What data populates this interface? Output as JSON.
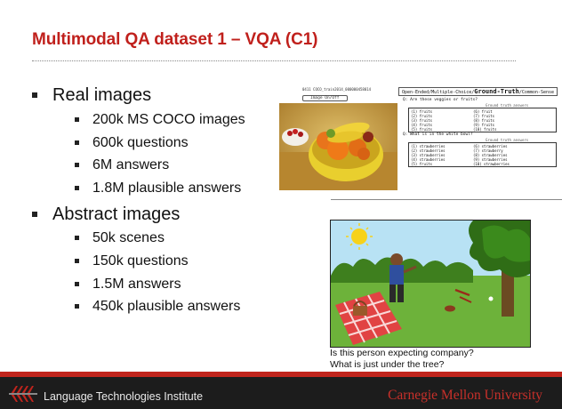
{
  "title": "Multimodal QA dataset 1 – VQA (C1)",
  "sections": [
    {
      "label": "Real images",
      "items": [
        "200k MS COCO images",
        "600k questions",
        "6M answers",
        "1.8M plausible answers"
      ]
    },
    {
      "label": "Abstract images",
      "items": [
        "50k scenes",
        "150k questions",
        "1.5M answers",
        "450k plausible answers"
      ]
    }
  ],
  "real_image_panel": {
    "filename": "0411   COCO_train2014_000000458014",
    "image_button": "Image On/Off"
  },
  "qa_panel": {
    "header_prefix": "Open-Ended/Multiple-Choice/",
    "header_main": "Ground-Truth",
    "header_suffix": "/Common-Sense",
    "questions": [
      {
        "question": "Q: Are these veggies or fruits?",
        "subheader": "Ground truth answers",
        "answers_left": [
          "(1) fruits",
          "(2) fruits",
          "(3) fruits",
          "(4) fruits",
          "(5) fruits"
        ],
        "answers_right": [
          "(6) fruit",
          "(7) fruits",
          "(8) fruits",
          "(9) fruits",
          "(10) fruits"
        ]
      },
      {
        "question": "Q: What is in the white bowl?",
        "subheader": "Ground truth answers",
        "answers_left": [
          "(1) strawberries",
          "(2) strawberries",
          "(3) strawberries",
          "(4) strawberries",
          "(5) fruits"
        ],
        "answers_right": [
          "(6) strawberries",
          "(7) strawberry",
          "(8) strawberries",
          "(9) strawberries",
          "(10) strawberries"
        ]
      }
    ]
  },
  "abstract_captions": [
    "Is this person expecting company?",
    "What is just under the tree?"
  ],
  "footer": {
    "left_text": "Language Technologies Institute",
    "right_text": "Carnegie Mellon University"
  },
  "colors": {
    "title": "#c0201c",
    "footer_bar": "#c0241c",
    "footer_bg": "#1c1c1c",
    "cmu_text": "#c8302a"
  }
}
